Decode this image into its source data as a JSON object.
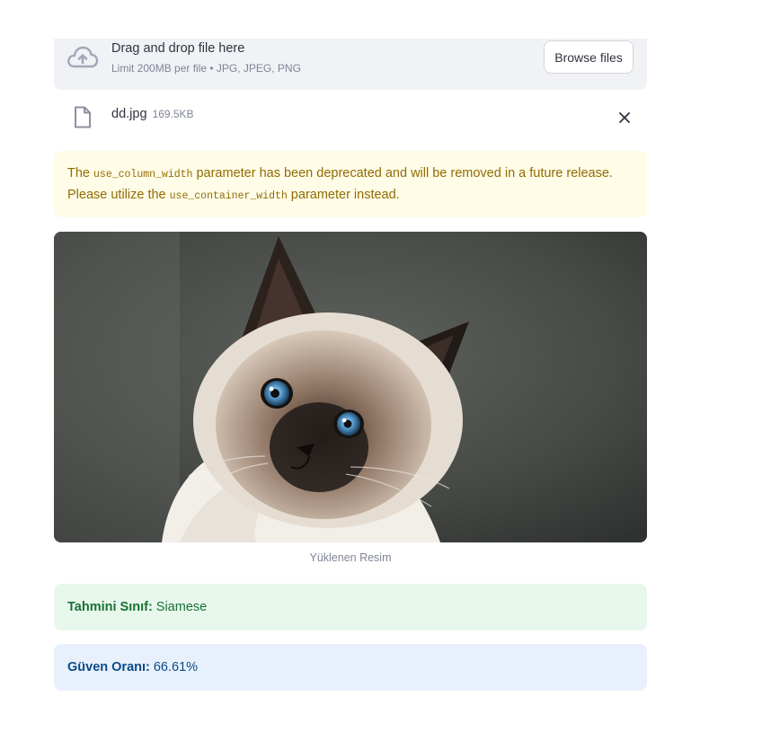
{
  "uploader": {
    "title": "Drag and drop file here",
    "limit_text": "Limit 200MB per file • JPG, JPEG, PNG",
    "browse_label": "Browse files",
    "icon": "cloud-upload-icon"
  },
  "file": {
    "name": "dd.jpg",
    "size": "169.5KB",
    "icon": "file-icon",
    "remove_icon": "close-icon"
  },
  "warning": {
    "part1": "The ",
    "code1": "use_column_width",
    "part2": " parameter has been deprecated and will be removed in a future release. Please utilize the ",
    "code2": "use_container_width",
    "part3": " parameter instead."
  },
  "image": {
    "caption": "Yüklenen Resim"
  },
  "prediction": {
    "label": "Tahmini Sınıf:",
    "value": "Siamese"
  },
  "confidence": {
    "label": "Güven Oranı:",
    "value": "66.61%"
  },
  "colors": {
    "warning_bg": "#fffce7",
    "warning_text": "#926c05",
    "success_bg": "#e8f7ec",
    "success_text": "#177233",
    "info_bg": "#e7f0fb",
    "info_text": "#0c4a8a"
  }
}
